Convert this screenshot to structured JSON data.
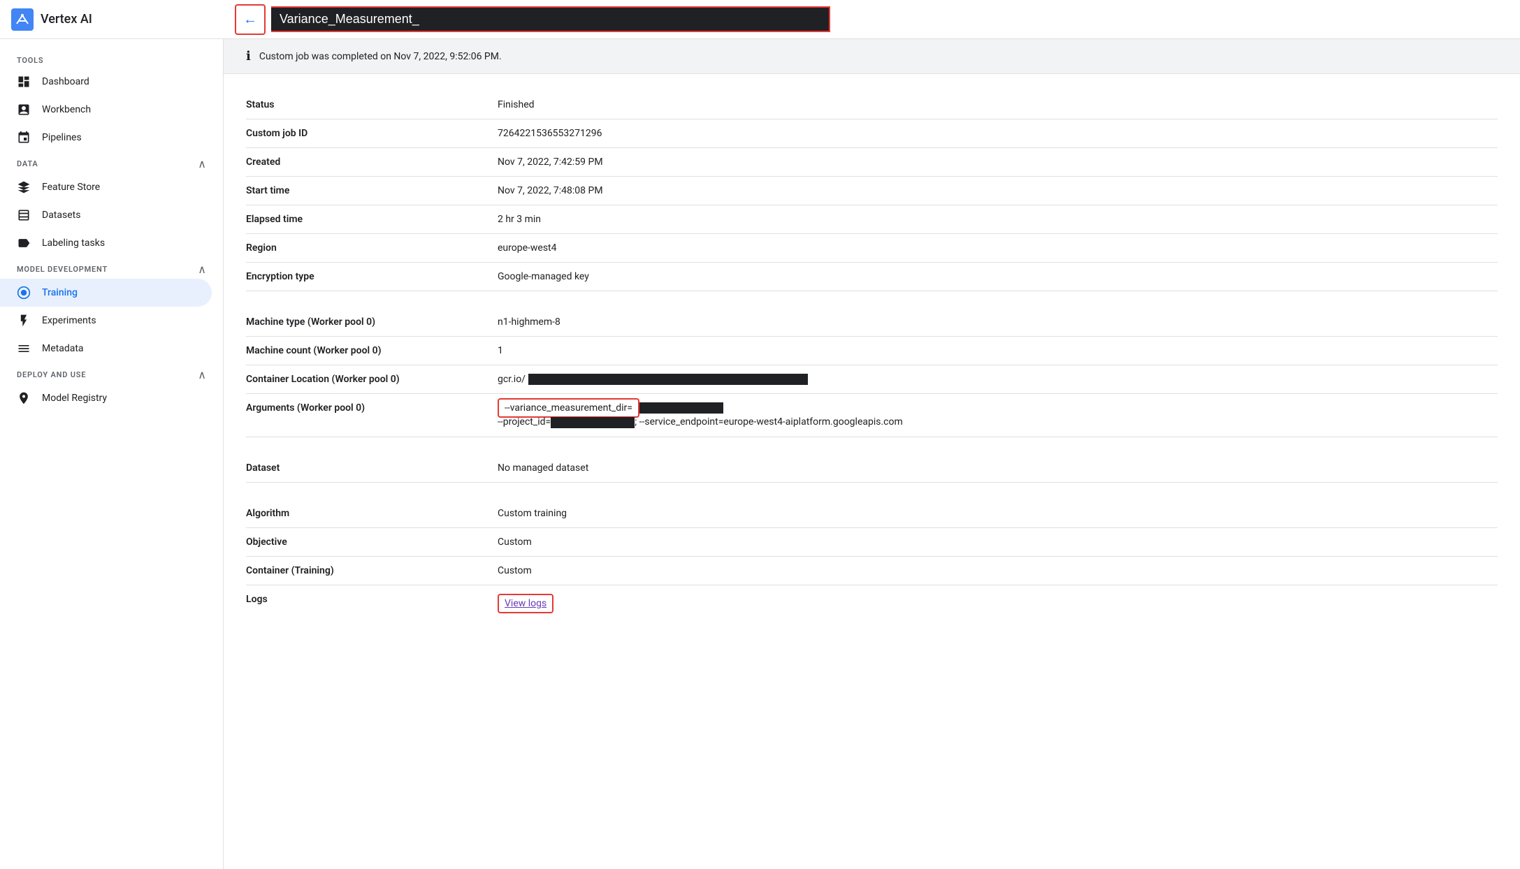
{
  "app": {
    "title": "Vertex AI",
    "back_button_label": "←",
    "page_name": "Variance_Measurement_"
  },
  "banner": {
    "message": "Custom job was completed on Nov 7, 2022, 9:52:06 PM."
  },
  "sidebar": {
    "tools_label": "TOOLS",
    "data_label": "DATA",
    "model_dev_label": "MODEL DEVELOPMENT",
    "deploy_label": "DEPLOY AND USE",
    "items": [
      {
        "id": "dashboard",
        "label": "Dashboard",
        "icon": "dashboard"
      },
      {
        "id": "workbench",
        "label": "Workbench",
        "icon": "workbench"
      },
      {
        "id": "pipelines",
        "label": "Pipelines",
        "icon": "pipelines"
      },
      {
        "id": "feature-store",
        "label": "Feature Store",
        "icon": "feature-store"
      },
      {
        "id": "datasets",
        "label": "Datasets",
        "icon": "datasets"
      },
      {
        "id": "labeling-tasks",
        "label": "Labeling tasks",
        "icon": "label"
      },
      {
        "id": "training",
        "label": "Training",
        "icon": "training",
        "active": true
      },
      {
        "id": "experiments",
        "label": "Experiments",
        "icon": "experiments"
      },
      {
        "id": "metadata",
        "label": "Metadata",
        "icon": "metadata"
      },
      {
        "id": "model-registry",
        "label": "Model Registry",
        "icon": "model-registry"
      }
    ]
  },
  "details": {
    "rows": [
      {
        "id": "status",
        "label": "Status",
        "value": "Finished"
      },
      {
        "id": "custom-job-id",
        "label": "Custom job ID",
        "value": "7264221536553271296"
      },
      {
        "id": "created",
        "label": "Created",
        "value": "Nov 7, 2022, 7:42:59 PM"
      },
      {
        "id": "start-time",
        "label": "Start time",
        "value": "Nov 7, 2022, 7:48:08 PM"
      },
      {
        "id": "elapsed-time",
        "label": "Elapsed time",
        "value": "2 hr 3 min"
      },
      {
        "id": "region",
        "label": "Region",
        "value": "europe-west4"
      },
      {
        "id": "encryption-type",
        "label": "Encryption type",
        "value": "Google-managed key"
      },
      {
        "id": "machine-type",
        "label": "Machine type (Worker pool 0)",
        "value": "n1-highmem-8"
      },
      {
        "id": "machine-count",
        "label": "Machine count (Worker pool 0)",
        "value": "1"
      },
      {
        "id": "container-location",
        "label": "Container Location (Worker pool 0)",
        "value": "gcr.io/"
      },
      {
        "id": "arguments",
        "label": "Arguments (Worker pool 0)",
        "value_line1": "--variance_measurement_dir=",
        "value_line2": "--project_id=",
        "value_suffix": "; --service_endpoint=europe-west4-aiplatform.googleapis.com"
      },
      {
        "id": "dataset",
        "label": "Dataset",
        "value": "No managed dataset"
      },
      {
        "id": "algorithm",
        "label": "Algorithm",
        "value": "Custom training"
      },
      {
        "id": "objective",
        "label": "Objective",
        "value": "Custom"
      },
      {
        "id": "container-training",
        "label": "Container (Training)",
        "value": "Custom"
      },
      {
        "id": "logs",
        "label": "Logs",
        "value": "View logs"
      }
    ]
  }
}
